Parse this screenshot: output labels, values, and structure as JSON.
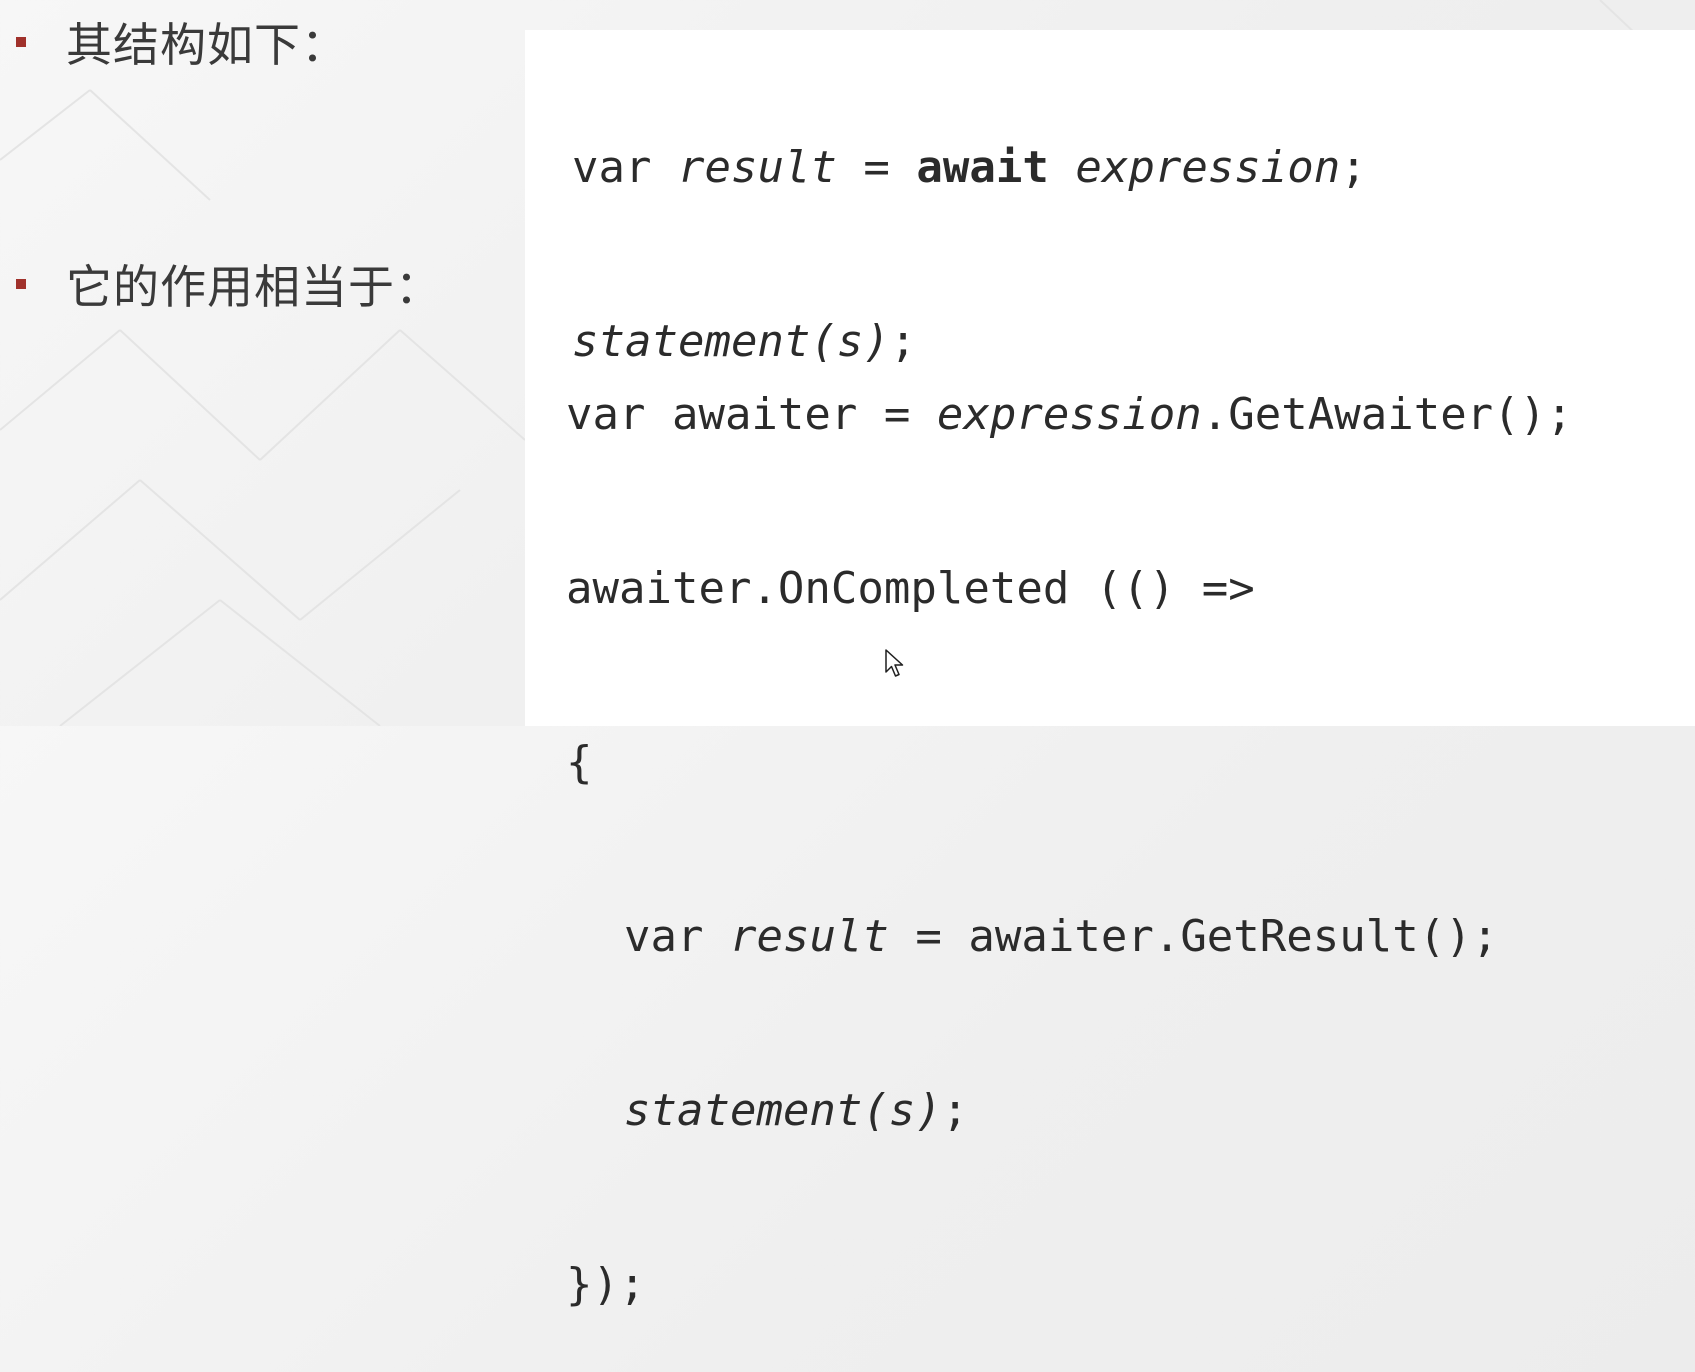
{
  "slide": {
    "bullets": [
      {
        "text": "其结构如下："
      },
      {
        "text": "它的作用相当于："
      }
    ],
    "code_structure": {
      "line1": {
        "kw_var": "var ",
        "var_result": "result",
        "eq": " = ",
        "kw_await": "await",
        "space": " ",
        "expr": "expression",
        "semi": ";"
      },
      "line2": {
        "stmt": "statement(s)",
        "semi": ";"
      }
    },
    "code_equivalent": {
      "line1": {
        "a": "var awaiter = ",
        "expr": "expression",
        "b": ".GetAwaiter();"
      },
      "line2": {
        "a": "awaiter.OnCompleted (() =>"
      },
      "line3": {
        "a": "{"
      },
      "line4": {
        "kw_var": "var ",
        "var_result": "result",
        "b": " = awaiter.GetResult();"
      },
      "line5": {
        "stmt": "statement(s)",
        "semi": ";"
      },
      "line6": {
        "a": "});"
      }
    }
  },
  "colors": {
    "bullet_accent": "#a0312b",
    "code_text": "#2b2b2b",
    "panel_bg": "#ffffff"
  },
  "icons": {
    "cursor": "mouse-pointer-icon"
  }
}
